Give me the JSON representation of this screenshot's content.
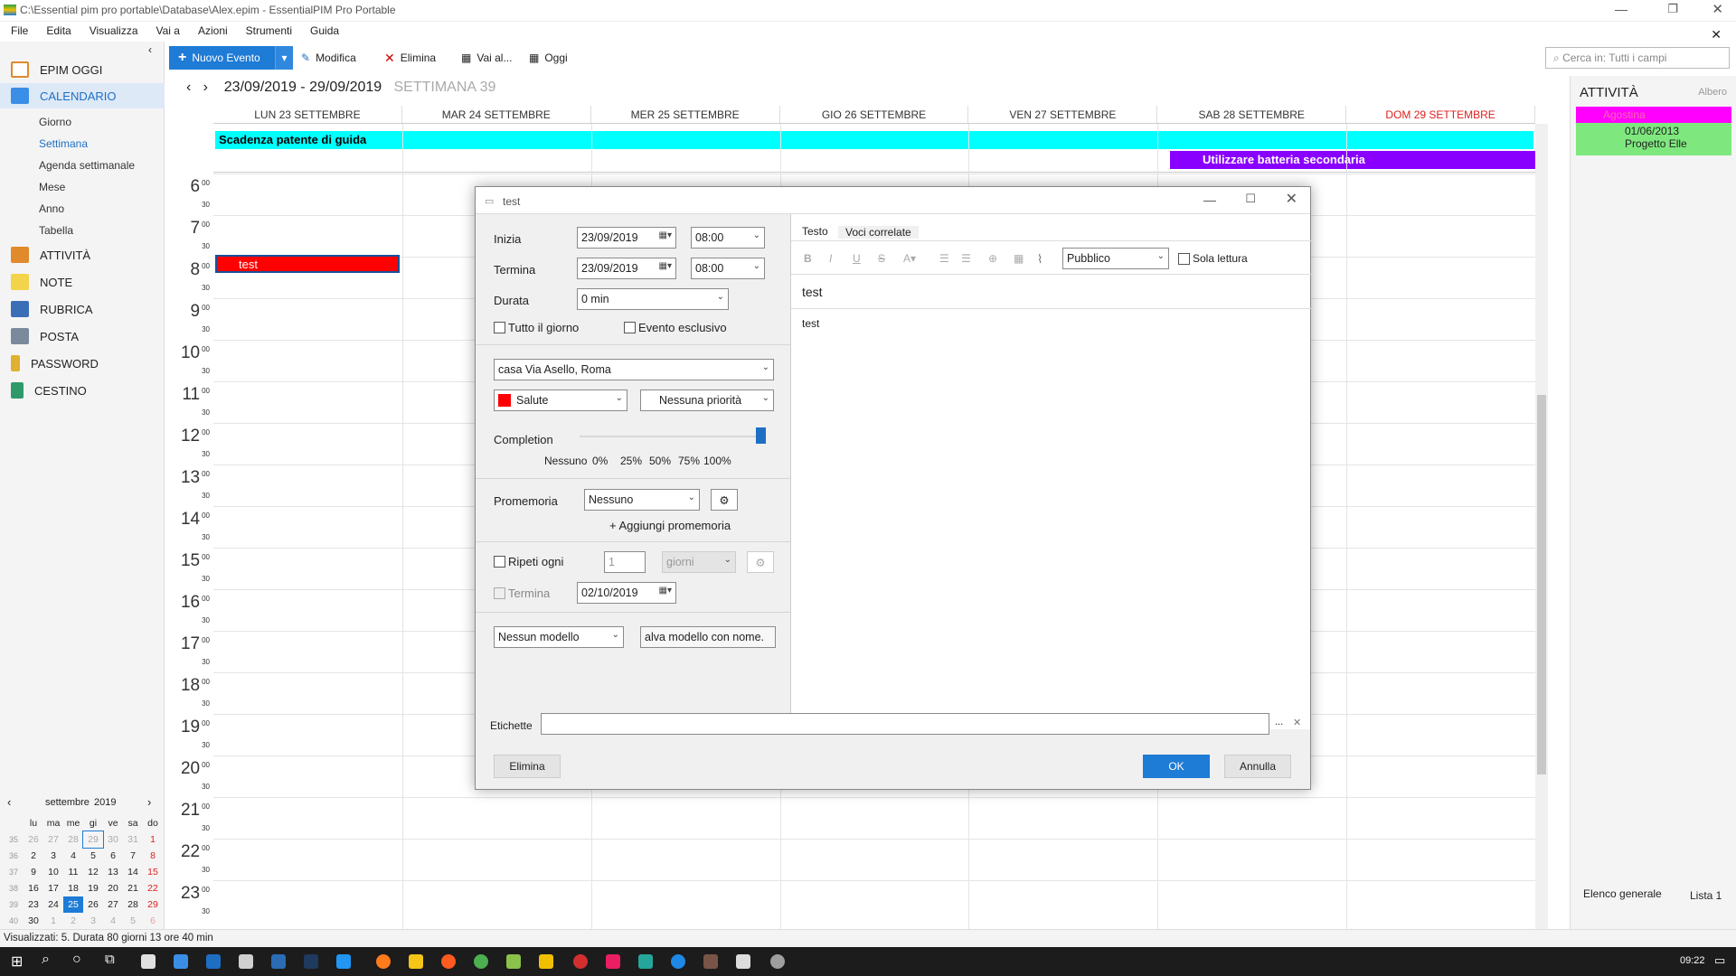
{
  "window": {
    "title": "C:\\Essential pim pro portable\\Database\\Alex.epim - EssentialPIM Pro Portable"
  },
  "menu": [
    "File",
    "Edita",
    "Visualizza",
    "Vai a",
    "Azioni",
    "Strumenti",
    "Guida"
  ],
  "toolbar": {
    "new_event": "Nuovo Evento",
    "edit": "Modifica",
    "delete": "Elimina",
    "goto": "Vai al...",
    "today": "Oggi"
  },
  "search": {
    "placeholder": "Cerca in: Tutti i campi"
  },
  "sidebar": {
    "modules": [
      "EPIM OGGI",
      "CALENDARIO",
      "ATTIVITÀ",
      "NOTE",
      "RUBRICA",
      "POSTA",
      "PASSWORD",
      "CESTINO"
    ],
    "calendar_views": [
      "Giorno",
      "Settimana",
      "Agenda settimanale",
      "Mese",
      "Anno",
      "Tabella"
    ]
  },
  "minical": {
    "month": "settembre",
    "year": "2019",
    "weekdays": [
      "lu",
      "ma",
      "me",
      "gi",
      "ve",
      "sa",
      "do"
    ],
    "weeks": [
      {
        "wk": "35",
        "days": [
          "26",
          "27",
          "28",
          "29",
          "30",
          "31",
          "1"
        ]
      },
      {
        "wk": "36",
        "days": [
          "2",
          "3",
          "4",
          "5",
          "6",
          "7",
          "8"
        ]
      },
      {
        "wk": "37",
        "days": [
          "9",
          "10",
          "11",
          "12",
          "13",
          "14",
          "15"
        ]
      },
      {
        "wk": "38",
        "days": [
          "16",
          "17",
          "18",
          "19",
          "20",
          "21",
          "22"
        ]
      },
      {
        "wk": "39",
        "days": [
          "23",
          "24",
          "25",
          "26",
          "27",
          "28",
          "29"
        ]
      },
      {
        "wk": "40",
        "days": [
          "30",
          "1",
          "2",
          "3",
          "4",
          "5",
          "6"
        ]
      }
    ],
    "today": "25"
  },
  "calendar": {
    "range": "23/09/2019 - 29/09/2019",
    "week_label": "SETTIMANA 39",
    "days": [
      "LUN 23 SETTEMBRE",
      "MAR 24 SETTEMBRE",
      "MER 25 SETTEMBRE",
      "GIO 26 SETTEMBRE",
      "VEN 27 SETTEMBRE",
      "SAB 28 SETTEMBRE",
      "DOM 29 SETTEMBRE"
    ],
    "allday_events": [
      {
        "title": "Scadenza patente di guida",
        "color": "#00ffff"
      },
      {
        "title": "Utilizzare batteria secondaria",
        "color": "#8a00ff"
      }
    ],
    "hours": [
      "6",
      "7",
      "8",
      "9",
      "10",
      "11",
      "12",
      "13",
      "14",
      "15",
      "16",
      "17",
      "18",
      "19",
      "20",
      "21",
      "22",
      "23"
    ],
    "minute_zero": "00",
    "minute_half": "30",
    "event": {
      "title": "test",
      "color": "#ff0000"
    }
  },
  "right_panel": {
    "title": "ATTIVITÀ",
    "view": "Albero",
    "items": [
      {
        "label": "Agostina",
        "color": "#ff00ff"
      },
      {
        "label": "01/06/2013",
        "sub": "Progetto Elle",
        "color": "#7ee87e"
      }
    ],
    "tabs": [
      "Elenco generale",
      "Lista 1"
    ]
  },
  "dialog": {
    "title": "test",
    "start_label": "Inizia",
    "start_date": "23/09/2019",
    "start_time": "08:00",
    "end_label": "Termina",
    "end_date": "23/09/2019",
    "end_time": "08:00",
    "duration_label": "Durata",
    "duration": "0 min",
    "allday_label": "Tutto il giorno",
    "exclusive_label": "Evento esclusivo",
    "location": "casa Via Asello, Roma",
    "category": "Salute",
    "priority": "Nessuna priorità",
    "completion_label": "Completion",
    "completion_ticks": [
      "Nessuno",
      "0%",
      "25%",
      "50%",
      "75%",
      "100%"
    ],
    "completion_value": 100,
    "reminder_label": "Promemoria",
    "reminder_value": "Nessuno",
    "add_reminder": "Aggiungi promemoria",
    "repeat_label": "Ripeti ogni",
    "repeat_count": "1",
    "repeat_unit": "giorni",
    "repeat_end_label": "Termina",
    "repeat_end_date": "02/10/2019",
    "template": "Nessun modello",
    "save_template": "alva modello con nome.",
    "tabs": [
      "Testo",
      "Voci correlate"
    ],
    "visibility": "Pubblico",
    "readonly_label": "Sola lettura",
    "subject": "test",
    "body": "test",
    "tags_label": "Etichette",
    "delete_btn": "Elimina",
    "ok_btn": "OK",
    "cancel_btn": "Annulla"
  },
  "status": {
    "text": "Visualizzati: 5. Durata 80 giorni 13 ore 40 min"
  },
  "taskbar": {
    "time": "09:22"
  }
}
